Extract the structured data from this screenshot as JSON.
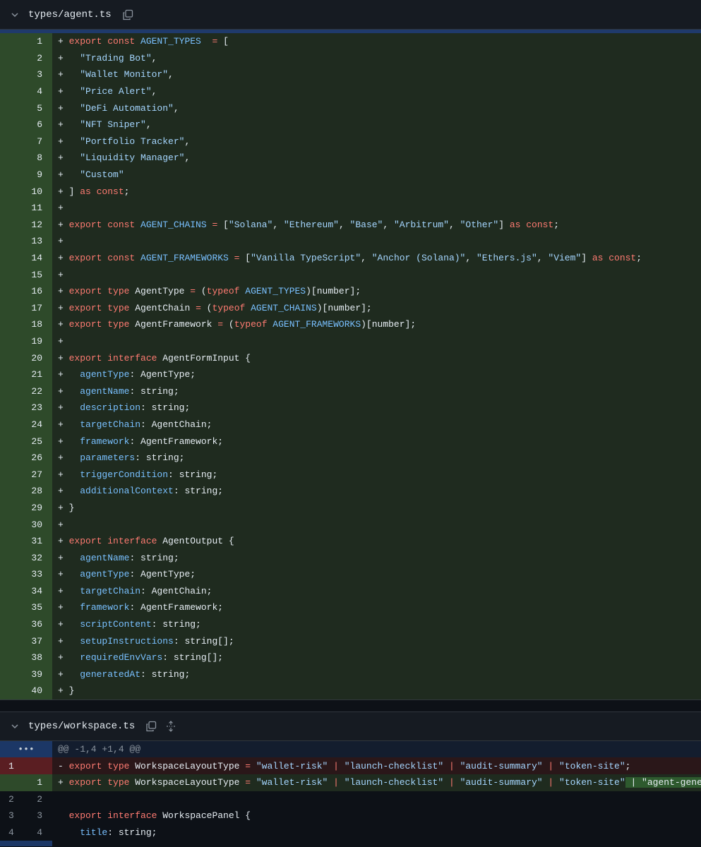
{
  "file1": {
    "name": "types/agent.ts",
    "lines": [
      {
        "n": "1",
        "s": "+",
        "t": [
          [
            "kw",
            "export const "
          ],
          [
            "cn",
            "AGENT_TYPES"
          ],
          [
            "",
            "  "
          ],
          [
            "kw",
            "="
          ],
          [
            "",
            " ["
          ]
        ]
      },
      {
        "n": "2",
        "s": "+",
        "t": [
          [
            "st",
            "  \"Trading Bot\""
          ],
          [
            "",
            ","
          ]
        ]
      },
      {
        "n": "3",
        "s": "+",
        "t": [
          [
            "st",
            "  \"Wallet Monitor\""
          ],
          [
            "",
            ","
          ]
        ]
      },
      {
        "n": "4",
        "s": "+",
        "t": [
          [
            "st",
            "  \"Price Alert\""
          ],
          [
            "",
            ","
          ]
        ]
      },
      {
        "n": "5",
        "s": "+",
        "t": [
          [
            "st",
            "  \"DeFi Automation\""
          ],
          [
            "",
            ","
          ]
        ]
      },
      {
        "n": "6",
        "s": "+",
        "t": [
          [
            "st",
            "  \"NFT Sniper\""
          ],
          [
            "",
            ","
          ]
        ]
      },
      {
        "n": "7",
        "s": "+",
        "t": [
          [
            "st",
            "  \"Portfolio Tracker\""
          ],
          [
            "",
            ","
          ]
        ]
      },
      {
        "n": "8",
        "s": "+",
        "t": [
          [
            "st",
            "  \"Liquidity Manager\""
          ],
          [
            "",
            ","
          ]
        ]
      },
      {
        "n": "9",
        "s": "+",
        "t": [
          [
            "st",
            "  \"Custom\""
          ]
        ]
      },
      {
        "n": "10",
        "s": "+",
        "t": [
          [
            "",
            "] "
          ],
          [
            "kw",
            "as const"
          ],
          [
            "",
            ";"
          ]
        ]
      },
      {
        "n": "11",
        "s": "+",
        "t": []
      },
      {
        "n": "12",
        "s": "+",
        "t": [
          [
            "kw",
            "export const "
          ],
          [
            "cn",
            "AGENT_CHAINS"
          ],
          [
            "",
            " "
          ],
          [
            "kw",
            "="
          ],
          [
            "",
            " ["
          ],
          [
            "st",
            "\"Solana\""
          ],
          [
            "",
            ", "
          ],
          [
            "st",
            "\"Ethereum\""
          ],
          [
            "",
            ", "
          ],
          [
            "st",
            "\"Base\""
          ],
          [
            "",
            ", "
          ],
          [
            "st",
            "\"Arbitrum\""
          ],
          [
            "",
            ", "
          ],
          [
            "st",
            "\"Other\""
          ],
          [
            "",
            "] "
          ],
          [
            "kw",
            "as const"
          ],
          [
            "",
            ";"
          ]
        ]
      },
      {
        "n": "13",
        "s": "+",
        "t": []
      },
      {
        "n": "14",
        "s": "+",
        "t": [
          [
            "kw",
            "export const "
          ],
          [
            "cn",
            "AGENT_FRAMEWORKS"
          ],
          [
            "",
            " "
          ],
          [
            "kw",
            "="
          ],
          [
            "",
            " ["
          ],
          [
            "st",
            "\"Vanilla TypeScript\""
          ],
          [
            "",
            ", "
          ],
          [
            "st",
            "\"Anchor (Solana)\""
          ],
          [
            "",
            ", "
          ],
          [
            "st",
            "\"Ethers.js\""
          ],
          [
            "",
            ", "
          ],
          [
            "st",
            "\"Viem\""
          ],
          [
            "",
            "] "
          ],
          [
            "kw",
            "as const"
          ],
          [
            "",
            ";"
          ]
        ]
      },
      {
        "n": "15",
        "s": "+",
        "t": []
      },
      {
        "n": "16",
        "s": "+",
        "t": [
          [
            "kw",
            "export type "
          ],
          [
            "",
            "AgentType "
          ],
          [
            "kw",
            "="
          ],
          [
            "",
            " ("
          ],
          [
            "kw",
            "typeof "
          ],
          [
            "cn",
            "AGENT_TYPES"
          ],
          [
            "",
            ")[number];"
          ]
        ]
      },
      {
        "n": "17",
        "s": "+",
        "t": [
          [
            "kw",
            "export type "
          ],
          [
            "",
            "AgentChain "
          ],
          [
            "kw",
            "="
          ],
          [
            "",
            " ("
          ],
          [
            "kw",
            "typeof "
          ],
          [
            "cn",
            "AGENT_CHAINS"
          ],
          [
            "",
            ")[number];"
          ]
        ]
      },
      {
        "n": "18",
        "s": "+",
        "t": [
          [
            "kw",
            "export type "
          ],
          [
            "",
            "AgentFramework "
          ],
          [
            "kw",
            "="
          ],
          [
            "",
            " ("
          ],
          [
            "kw",
            "typeof "
          ],
          [
            "cn",
            "AGENT_FRAMEWORKS"
          ],
          [
            "",
            ")[number];"
          ]
        ]
      },
      {
        "n": "19",
        "s": "+",
        "t": []
      },
      {
        "n": "20",
        "s": "+",
        "t": [
          [
            "kw",
            "export interface "
          ],
          [
            "",
            "AgentFormInput {"
          ]
        ]
      },
      {
        "n": "21",
        "s": "+",
        "t": [
          [
            "pr",
            "  agentType"
          ],
          [
            "",
            ": AgentType;"
          ]
        ]
      },
      {
        "n": "22",
        "s": "+",
        "t": [
          [
            "pr",
            "  agentName"
          ],
          [
            "",
            ": string;"
          ]
        ]
      },
      {
        "n": "23",
        "s": "+",
        "t": [
          [
            "pr",
            "  description"
          ],
          [
            "",
            ": string;"
          ]
        ]
      },
      {
        "n": "24",
        "s": "+",
        "t": [
          [
            "pr",
            "  targetChain"
          ],
          [
            "",
            ": AgentChain;"
          ]
        ]
      },
      {
        "n": "25",
        "s": "+",
        "t": [
          [
            "pr",
            "  framework"
          ],
          [
            "",
            ": AgentFramework;"
          ]
        ]
      },
      {
        "n": "26",
        "s": "+",
        "t": [
          [
            "pr",
            "  parameters"
          ],
          [
            "",
            ": string;"
          ]
        ]
      },
      {
        "n": "27",
        "s": "+",
        "t": [
          [
            "pr",
            "  triggerCondition"
          ],
          [
            "",
            ": string;"
          ]
        ]
      },
      {
        "n": "28",
        "s": "+",
        "t": [
          [
            "pr",
            "  additionalContext"
          ],
          [
            "",
            ": string;"
          ]
        ]
      },
      {
        "n": "29",
        "s": "+",
        "t": [
          [
            "",
            "}"
          ]
        ]
      },
      {
        "n": "30",
        "s": "+",
        "t": []
      },
      {
        "n": "31",
        "s": "+",
        "t": [
          [
            "kw",
            "export interface "
          ],
          [
            "",
            "AgentOutput {"
          ]
        ]
      },
      {
        "n": "32",
        "s": "+",
        "t": [
          [
            "pr",
            "  agentName"
          ],
          [
            "",
            ": string;"
          ]
        ]
      },
      {
        "n": "33",
        "s": "+",
        "t": [
          [
            "pr",
            "  agentType"
          ],
          [
            "",
            ": AgentType;"
          ]
        ]
      },
      {
        "n": "34",
        "s": "+",
        "t": [
          [
            "pr",
            "  targetChain"
          ],
          [
            "",
            ": AgentChain;"
          ]
        ]
      },
      {
        "n": "35",
        "s": "+",
        "t": [
          [
            "pr",
            "  framework"
          ],
          [
            "",
            ": AgentFramework;"
          ]
        ]
      },
      {
        "n": "36",
        "s": "+",
        "t": [
          [
            "pr",
            "  scriptContent"
          ],
          [
            "",
            ": string;"
          ]
        ]
      },
      {
        "n": "37",
        "s": "+",
        "t": [
          [
            "pr",
            "  setupInstructions"
          ],
          [
            "",
            ": string[];"
          ]
        ]
      },
      {
        "n": "38",
        "s": "+",
        "t": [
          [
            "pr",
            "  requiredEnvVars"
          ],
          [
            "",
            ": string[];"
          ]
        ]
      },
      {
        "n": "39",
        "s": "+",
        "t": [
          [
            "pr",
            "  generatedAt"
          ],
          [
            "",
            ": string;"
          ]
        ]
      },
      {
        "n": "40",
        "s": "+",
        "t": [
          [
            "",
            "}"
          ]
        ]
      }
    ]
  },
  "file2": {
    "name": "types/workspace.ts",
    "hunk": "@@ -1,4 +1,4 @@",
    "expand": "•••",
    "lines": [
      {
        "type": "del",
        "o": "1",
        "n": "",
        "s": "-",
        "t": [
          [
            "kw",
            "export type "
          ],
          [
            "",
            "WorkspaceLayoutType "
          ],
          [
            "kw",
            "="
          ],
          [
            "",
            ""
          ],
          [
            "st",
            " \"wallet-risk\""
          ],
          [
            "",
            " "
          ],
          [
            "kw",
            "|"
          ],
          [
            "st",
            " \"launch-checklist\""
          ],
          [
            "",
            " "
          ],
          [
            "kw",
            "|"
          ],
          [
            "st",
            " \"audit-summary\""
          ],
          [
            "",
            " "
          ],
          [
            "kw",
            "|"
          ],
          [
            "st",
            " \"token-site\""
          ],
          [
            "",
            ";"
          ]
        ]
      },
      {
        "type": "add",
        "o": "",
        "n": "1",
        "s": "+",
        "t": [
          [
            "kw",
            "export type "
          ],
          [
            "",
            "WorkspaceLayoutType "
          ],
          [
            "kw",
            "="
          ],
          [
            "",
            ""
          ],
          [
            "st",
            " \"wallet-risk\""
          ],
          [
            "",
            " "
          ],
          [
            "kw",
            "|"
          ],
          [
            "st",
            " \"launch-checklist\""
          ],
          [
            "",
            " "
          ],
          [
            "kw",
            "|"
          ],
          [
            "st",
            " \"audit-summary\""
          ],
          [
            "",
            " "
          ],
          [
            "kw",
            "|"
          ],
          [
            "st",
            " \"token-site\""
          ],
          [
            "hl",
            " | \"agent-generator\""
          ],
          [
            "",
            ";"
          ]
        ]
      },
      {
        "type": "ctx",
        "o": "2",
        "n": "2",
        "s": " ",
        "t": []
      },
      {
        "type": "ctx",
        "o": "3",
        "n": "3",
        "s": " ",
        "t": [
          [
            "kw",
            "export interface "
          ],
          [
            "",
            "WorkspacePanel {"
          ]
        ]
      },
      {
        "type": "ctx",
        "o": "4",
        "n": "4",
        "s": " ",
        "t": [
          [
            "pr",
            "  title"
          ],
          [
            "",
            ": string;"
          ]
        ]
      }
    ]
  }
}
